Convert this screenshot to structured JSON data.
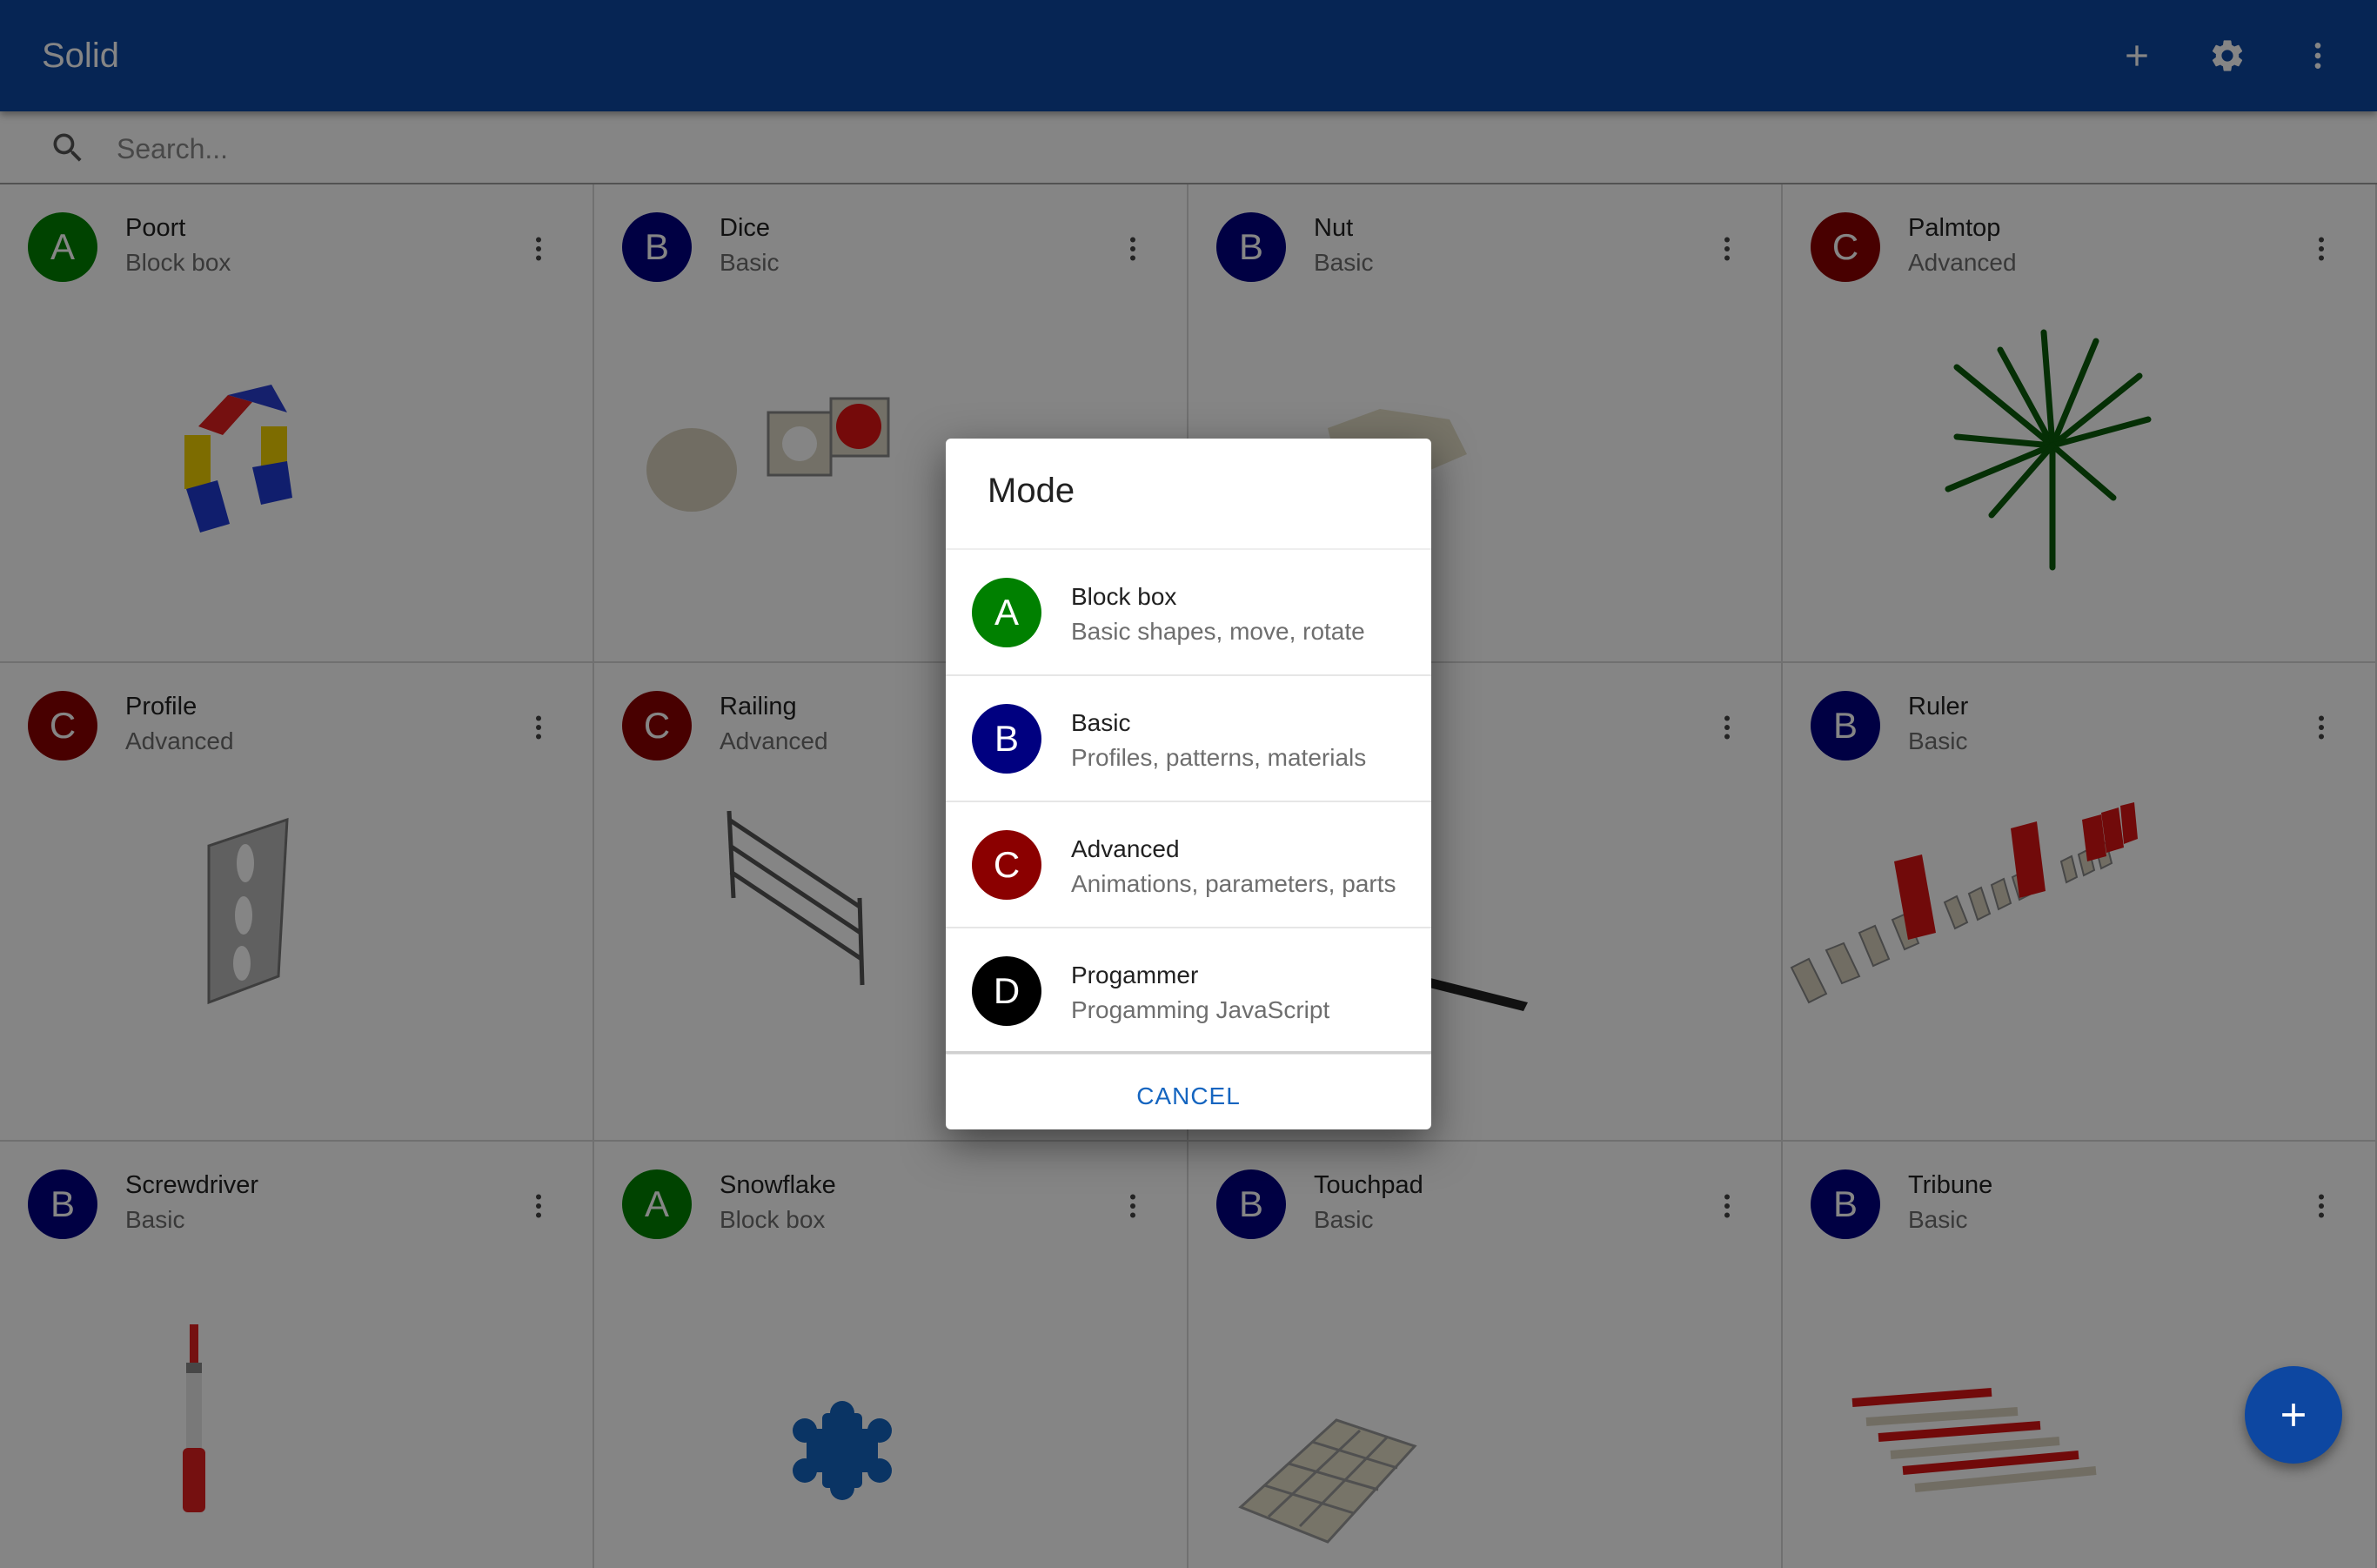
{
  "app": {
    "title": "Solid",
    "actions": [
      {
        "name": "add-icon"
      },
      {
        "name": "gear-icon"
      },
      {
        "name": "more-vert-icon"
      }
    ]
  },
  "search": {
    "placeholder": "Search..."
  },
  "cards": [
    {
      "letter": "A",
      "title": "Poort",
      "mode": "Block box"
    },
    {
      "letter": "B",
      "title": "Dice",
      "mode": "Basic"
    },
    {
      "letter": "B",
      "title": "Nut",
      "mode": "Basic"
    },
    {
      "letter": "C",
      "title": "Palmtop",
      "mode": "Advanced"
    },
    {
      "letter": "C",
      "title": "Profile",
      "mode": "Advanced"
    },
    {
      "letter": "C",
      "title": "Railing",
      "mode": "Advanced"
    },
    {
      "letter": "",
      "title": "",
      "mode": ""
    },
    {
      "letter": "B",
      "title": "Ruler",
      "mode": "Basic"
    },
    {
      "letter": "B",
      "title": "Screwdriver",
      "mode": "Basic"
    },
    {
      "letter": "A",
      "title": "Snowflake",
      "mode": "Block box"
    },
    {
      "letter": "B",
      "title": "Touchpad",
      "mode": "Basic"
    },
    {
      "letter": "B",
      "title": "Tribune",
      "mode": "Basic"
    }
  ],
  "dialog": {
    "title": "Mode",
    "options": [
      {
        "letter": "A",
        "title": "Block box",
        "description": "Basic shapes, move, rotate"
      },
      {
        "letter": "B",
        "title": "Basic",
        "description": "Profiles, patterns, materials"
      },
      {
        "letter": "C",
        "title": "Advanced",
        "description": "Animations, parameters, parts"
      },
      {
        "letter": "D",
        "title": "Progammer",
        "description": "Progamming JavaScript"
      }
    ],
    "cancel_label": "CANCEL"
  },
  "fab": {
    "icon": "add-icon"
  },
  "colors": {
    "primary": "#0d47a1",
    "mode_a": "#008000",
    "mode_b": "#000080",
    "mode_c": "#8b0000",
    "mode_d": "#000000"
  }
}
